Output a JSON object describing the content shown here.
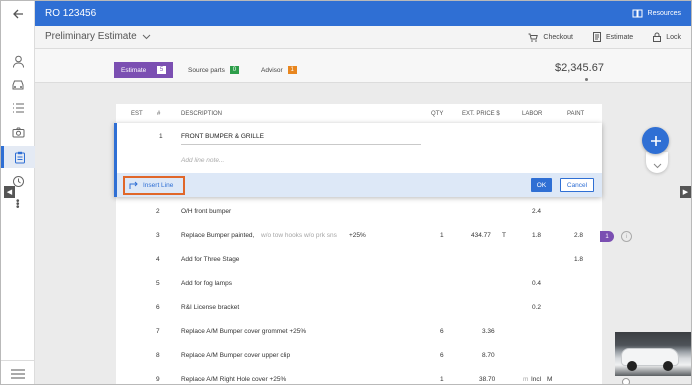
{
  "app": {
    "title": "RO 123456",
    "resources_label": "Resources"
  },
  "subheader": {
    "view_label": "Preliminary Estimate",
    "checkout_label": "Checkout",
    "estimate_label": "Estimate",
    "lock_label": "Lock"
  },
  "tabs": [
    {
      "label": "Estimate",
      "count": "5",
      "badge_color": "#ffffff"
    },
    {
      "label": "Source parts",
      "count": "0",
      "badge_color": "#2e9e4a"
    },
    {
      "label": "Advisor",
      "count": "1",
      "badge_color": "#e8861f"
    }
  ],
  "total": "$2,345.67",
  "table": {
    "headers": {
      "est": "EST",
      "num": "#",
      "description": "DESCRIPTION",
      "qty": "QTY",
      "ext_price": "EXT. PRICE $",
      "labor": "LABOR",
      "paint": "PAINT"
    },
    "editing_line": {
      "num": "1",
      "description": "FRONT BUMPER & GRILLE",
      "note_placeholder": "Add line note...",
      "insert_line_label": "Insert Line",
      "ok_label": "OK",
      "cancel_label": "Cancel"
    },
    "rows": [
      {
        "num": "2",
        "desc": "O/H front bumper",
        "desc_extra": "",
        "desc_suffix": "",
        "qty": "",
        "price": "",
        "price_flag": "",
        "labor_prefix": "",
        "labor": "2.4",
        "labor_flag": "",
        "paint": ""
      },
      {
        "num": "3",
        "desc": "Replace Bumper painted,",
        "desc_extra": "w/o tow hooks w/o prk sns",
        "desc_suffix": "+25%",
        "qty": "1",
        "price": "434.77",
        "price_flag": "T",
        "labor_prefix": "",
        "labor": "1.8",
        "labor_flag": "",
        "paint": "2.8"
      },
      {
        "num": "4",
        "desc": "Add for Three Stage",
        "desc_extra": "",
        "desc_suffix": "",
        "qty": "",
        "price": "",
        "price_flag": "",
        "labor_prefix": "",
        "labor": "",
        "labor_flag": "",
        "paint": "1.8"
      },
      {
        "num": "5",
        "desc": "Add for fog lamps",
        "desc_extra": "",
        "desc_suffix": "",
        "qty": "",
        "price": "",
        "price_flag": "",
        "labor_prefix": "",
        "labor": "0.4",
        "labor_flag": "",
        "paint": ""
      },
      {
        "num": "6",
        "desc": "R&I License bracket",
        "desc_extra": "",
        "desc_suffix": "",
        "qty": "",
        "price": "",
        "price_flag": "",
        "labor_prefix": "",
        "labor": "0.2",
        "labor_flag": "",
        "paint": ""
      },
      {
        "num": "7",
        "desc": "Replace A/M Bumper cover grommet +25%",
        "desc_extra": "",
        "desc_suffix": "",
        "qty": "6",
        "price": "3.36",
        "price_flag": "",
        "labor_prefix": "",
        "labor": "",
        "labor_flag": "",
        "paint": ""
      },
      {
        "num": "8",
        "desc": "Replace A/M Bumper cover upper clip",
        "desc_extra": "",
        "desc_suffix": "",
        "qty": "6",
        "price": "8.70",
        "price_flag": "",
        "labor_prefix": "",
        "labor": "",
        "labor_flag": "",
        "paint": ""
      },
      {
        "num": "9",
        "desc": "Replace A/M Right Hole cover +25%",
        "desc_extra": "",
        "desc_suffix": "",
        "qty": "1",
        "price": "38.70",
        "price_flag": "",
        "labor_prefix": "m",
        "labor": "Incl",
        "labor_flag": "M",
        "paint": ""
      }
    ]
  },
  "line_badge": "1",
  "info_glyph": "i",
  "icons": {
    "back": "arrow-left-icon",
    "rail": [
      "person-icon",
      "car-icon",
      "list-icon",
      "camera-icon",
      "clipboard-icon",
      "history-icon"
    ],
    "more": "more-vertical-icon",
    "menu": "hamburger-menu-icon",
    "resources": "book-icon",
    "checkout": "cart-icon",
    "estimate": "document-icon",
    "lock": "lock-icon",
    "add": "plus-icon",
    "collapse": "chevron-down-icon",
    "insert": "insert-line-icon"
  },
  "colors": {
    "brand_blue": "#2f6fd4",
    "tab_purple": "#7b4fb2",
    "highlight_orange": "#e0672a"
  }
}
